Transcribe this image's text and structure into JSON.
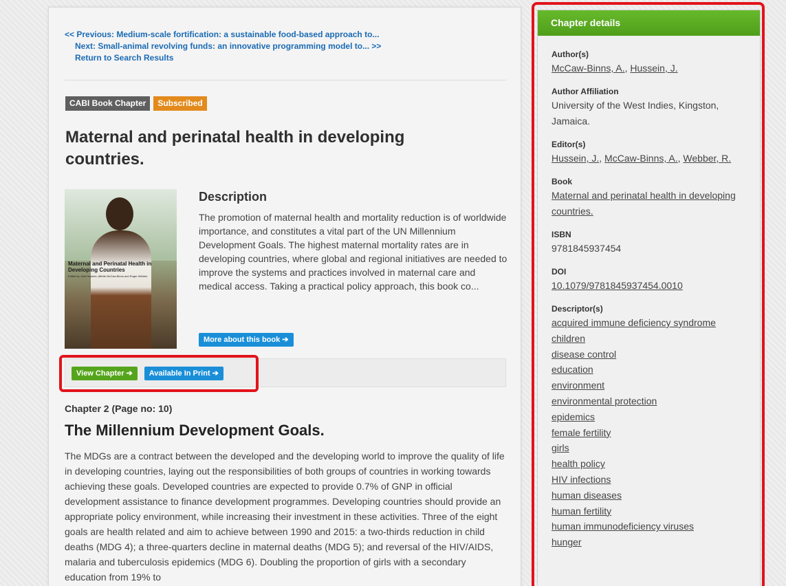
{
  "nav": {
    "previous": "<< Previous: Medium-scale fortification: a sustainable food-based approach to...",
    "next": "Next: Small-animal revolving funds: an innovative programming model to... >>",
    "back": "Return to Search Results"
  },
  "badges": {
    "type": "CABI Book Chapter",
    "status": "Subscribed"
  },
  "book_title": "Maternal and perinatal health in developing countries.",
  "cover": {
    "title": "Maternal and Perinatal Health in Developing Countries",
    "editors": "Edited by Julia Hussein, Affette McCaw-Binns and Roger Webber"
  },
  "description": {
    "heading": "Description",
    "text": "The promotion of maternal health and mortality reduction is of worldwide importance, and constitutes a vital part of the UN Millennium Development Goals. The highest maternal mortality rates are in developing countries, where global and regional initiatives are needed to improve the systems and practices involved in maternal care and medical access. Taking a practical policy approach, this book co...",
    "more_button": "More about this book ➔"
  },
  "actions": {
    "view": "View Chapter ➔",
    "print": "Available In Print ➔"
  },
  "chapter": {
    "number": "Chapter 2 (Page no: 10)",
    "title": "The Millennium Development Goals.",
    "body": "The MDGs are a contract between the developed and the developing world to improve the quality of life in developing countries, laying out the responsibilities of both groups of countries in working towards achieving these goals. Developed countries are expected to provide 0.7% of GNP in official development assistance to finance development programmes. Developing countries should provide an appropriate policy environment, while increasing their investment in these activities. Three of the eight goals are health related and aim to achieve between 1990 and 2015: a two-thirds reduction in child deaths (MDG 4); a three-quarters decline in maternal deaths (MDG 5); and reversal of the HIV/AIDS, malaria and tuberculosis epidemics (MDG 6). Doubling the proportion of girls with a secondary education from 19% to"
  },
  "sidebar": {
    "heading": "Chapter details",
    "authors_label": "Author(s)",
    "authors": [
      "McCaw-Binns, A.",
      "Hussein, J."
    ],
    "affiliation_label": "Author Affiliation",
    "affiliation": "University of the West Indies, Kingston, Jamaica.",
    "editors_label": "Editor(s)",
    "editors": [
      "Hussein, J.",
      "McCaw-Binns, A.",
      "Webber, R."
    ],
    "book_label": "Book",
    "book": "Maternal and perinatal health in developing countries.",
    "isbn_label": "ISBN",
    "isbn": "9781845937454",
    "doi_label": "DOI",
    "doi": "10.1079/9781845937454.0010",
    "descriptors_label": "Descriptor(s)",
    "descriptors": [
      "acquired immune deficiency syndrome",
      "children",
      "disease control",
      "education",
      "environment",
      "environmental protection",
      "epidemics",
      "female fertility",
      "girls",
      "health policy",
      "HIV infections",
      "human diseases",
      "human fertility",
      "human immunodeficiency viruses",
      "hunger"
    ]
  }
}
